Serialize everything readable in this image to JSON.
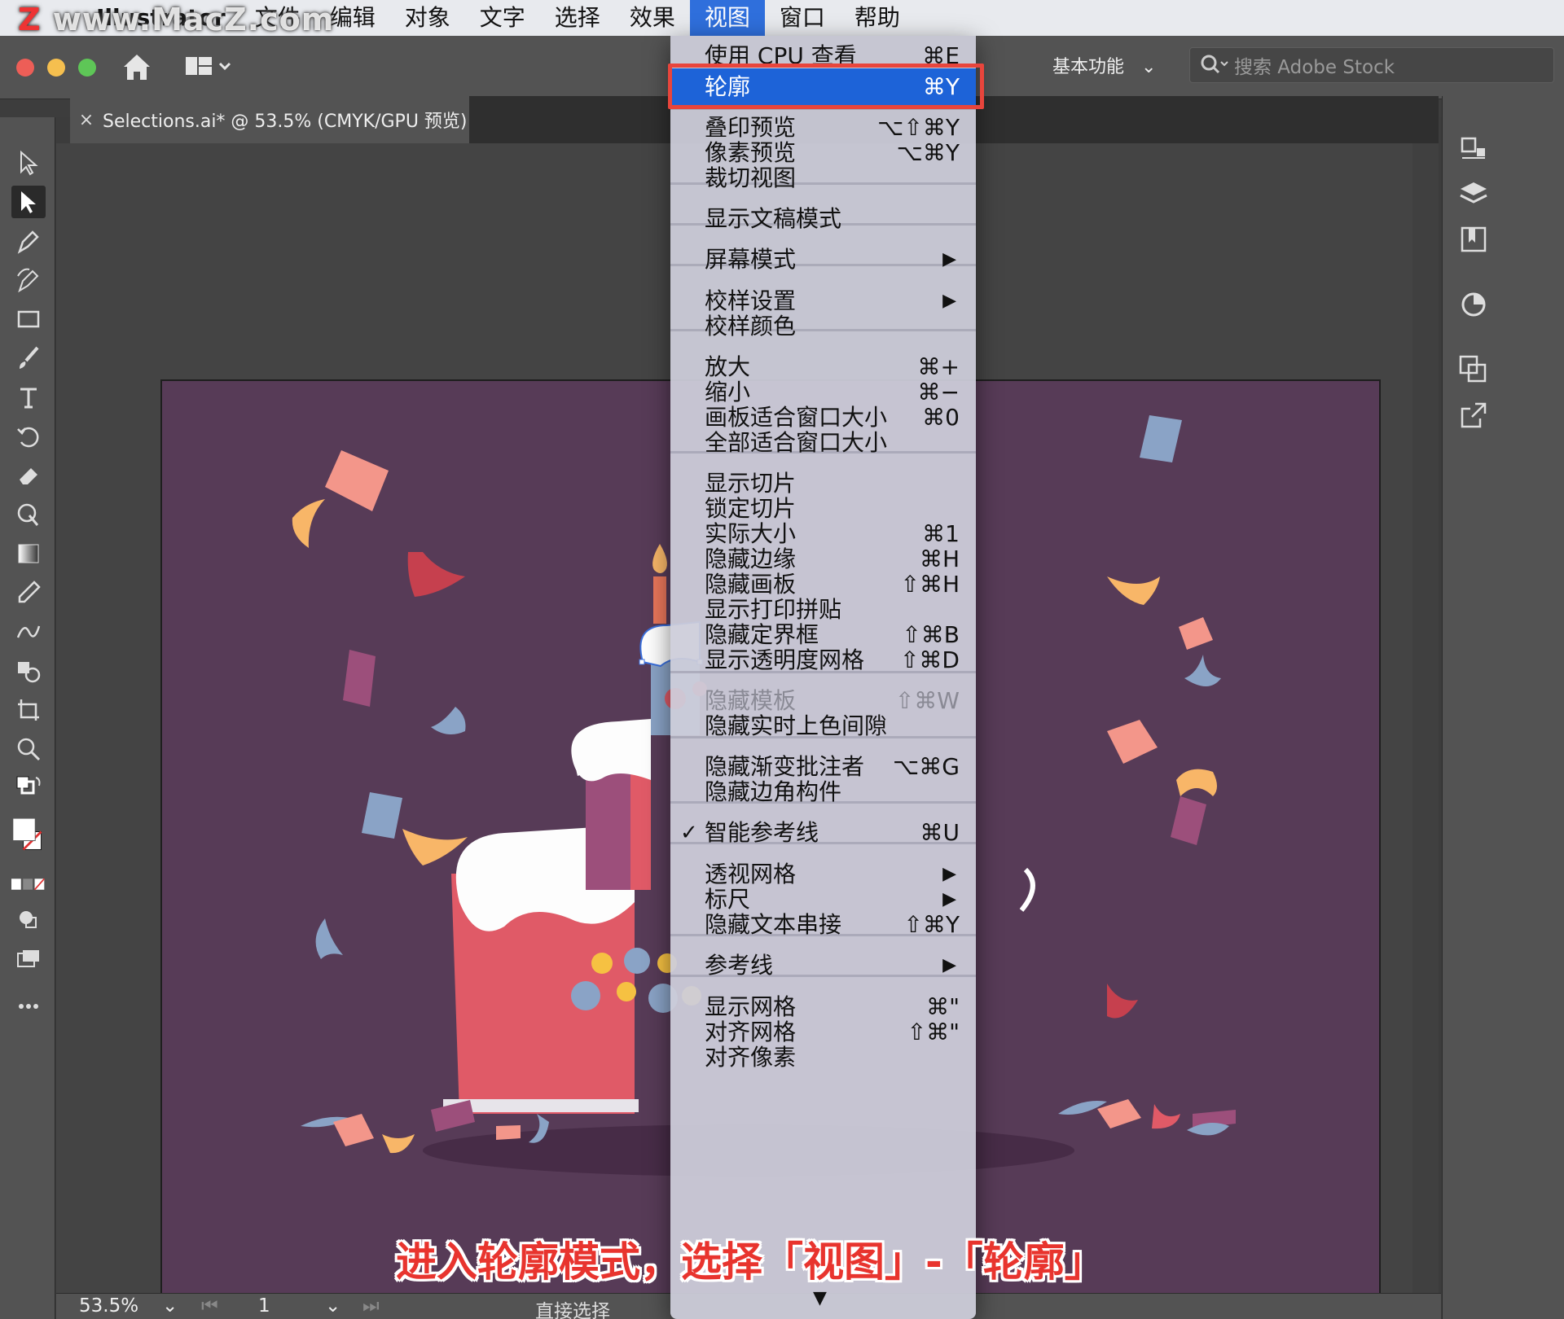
{
  "menubar": {
    "apple_glyph": "",
    "app_name": "Illustrator",
    "items": [
      "文件",
      "编辑",
      "对象",
      "文字",
      "选择",
      "效果",
      "视图",
      "窗口",
      "帮助"
    ],
    "active_item": "视图"
  },
  "watermark": {
    "text": "www.MacZ.com",
    "badge": "Z"
  },
  "appbar": {
    "workspace_label": "基本功能",
    "search_placeholder": "搜索 Adobe Stock"
  },
  "document_tab": {
    "close": "×",
    "title": "Selections.ai* @ 53.5% (CMYK/GPU 预览)"
  },
  "view_menu": {
    "items": [
      {
        "label": "使用 CPU 查看",
        "shortcut": "⌘E"
      },
      {
        "label": "轮廓",
        "shortcut": "⌘Y",
        "highlighted": true
      },
      {
        "label": "叠印预览",
        "shortcut": "⌥⇧⌘Y"
      },
      {
        "label": "像素预览",
        "shortcut": "⌥⌘Y"
      },
      {
        "label": "裁切视图",
        "shortcut": ""
      },
      {
        "label": "显示文稿模式",
        "shortcut": ""
      },
      {
        "label": "屏幕模式",
        "submenu": true
      },
      {
        "label": "校样设置",
        "submenu": true
      },
      {
        "label": "校样颜色",
        "shortcut": ""
      },
      {
        "label": "放大",
        "shortcut": "⌘+"
      },
      {
        "label": "缩小",
        "shortcut": "⌘−"
      },
      {
        "label": "画板适合窗口大小",
        "shortcut": "⌘0"
      },
      {
        "label": "全部适合窗口大小",
        "shortcut": ""
      },
      {
        "label": "显示切片",
        "shortcut": ""
      },
      {
        "label": "锁定切片",
        "shortcut": ""
      },
      {
        "label": "实际大小",
        "shortcut": "⌘1"
      },
      {
        "label": "隐藏边缘",
        "shortcut": "⌘H"
      },
      {
        "label": "隐藏画板",
        "shortcut": "⇧⌘H"
      },
      {
        "label": "显示打印拼贴",
        "shortcut": ""
      },
      {
        "label": "隐藏定界框",
        "shortcut": "⇧⌘B"
      },
      {
        "label": "显示透明度网格",
        "shortcut": "⇧⌘D"
      },
      {
        "label": "隐藏模板",
        "shortcut": "⇧⌘W",
        "disabled": true
      },
      {
        "label": "隐藏实时上色间隙",
        "shortcut": ""
      },
      {
        "label": "隐藏渐变批注者",
        "shortcut": "⌥⌘G"
      },
      {
        "label": "隐藏边角构件",
        "shortcut": ""
      },
      {
        "label": "智能参考线",
        "shortcut": "⌘U",
        "checked": true
      },
      {
        "label": "透视网格",
        "submenu": true
      },
      {
        "label": "标尺",
        "submenu": true
      },
      {
        "label": "隐藏文本串接",
        "shortcut": "⇧⌘Y"
      },
      {
        "label": "参考线",
        "submenu": true
      },
      {
        "label": "显示网格",
        "shortcut": "⌘\""
      },
      {
        "label": "对齐网格",
        "shortcut": "⇧⌘\""
      },
      {
        "label": "对齐像素",
        "shortcut": ""
      }
    ],
    "submenu_arrow": "▶",
    "check_mark": "✓",
    "more_arrow": "▼"
  },
  "statusbar": {
    "zoom": "53.5%",
    "page": "1",
    "tool_name": "直接选择"
  },
  "caption": "进入轮廓模式，选择「视图」-「轮廓」",
  "colors": {
    "artboard": "#573b57",
    "menu_highlight": "#1d63d8",
    "callout_red": "#e8453c",
    "cake_red": "#e05a67",
    "cake_blue": "#8aa3c6",
    "cake_pink": "#9c4f7b",
    "confetti_peach": "#f3968a",
    "confetti_orange": "#f8b668",
    "confetti_crimson": "#c6404e"
  }
}
